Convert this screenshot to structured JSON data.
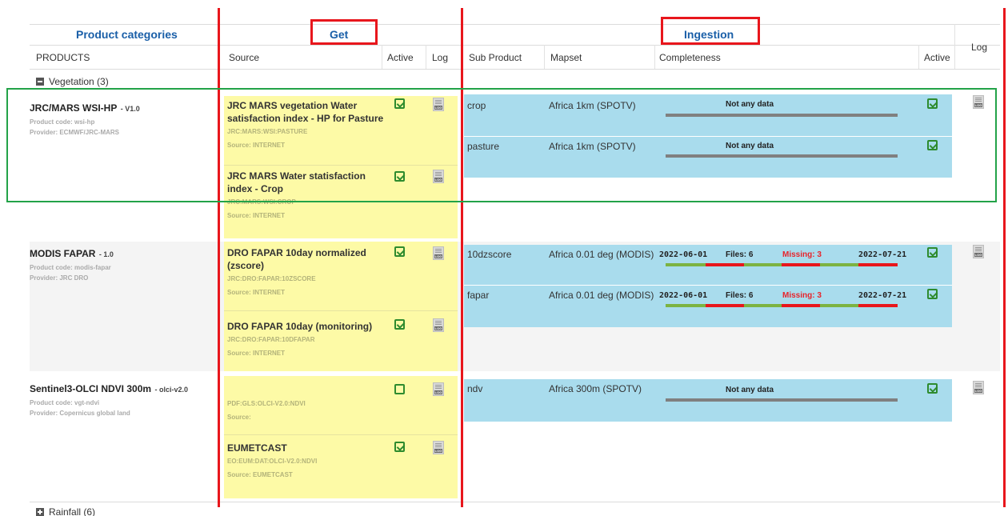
{
  "header": {
    "product_categories": "Product categories",
    "get": "Get",
    "ingestion": "Ingestion",
    "log": "Log"
  },
  "columns": {
    "products": "PRODUCTS",
    "source": "Source",
    "active": "Active",
    "log": "Log",
    "sub_product": "Sub Product",
    "mapset": "Mapset",
    "completeness": "Completeness",
    "ing_active": "Active"
  },
  "groups": {
    "vegetation": "Vegetation (3)",
    "rainfall": "Rainfall (6)"
  },
  "log_icon_text": "LOG",
  "products": [
    {
      "name": "JRC/MARS WSI-HP",
      "version": "- V1.0",
      "code": "Product code: wsi-hp",
      "provider": "Provider: ECMWF/JRC-MARS",
      "sources": [
        {
          "title": "JRC MARS vegetation Water satisfaction index - HP for Pasture",
          "code": "JRC:MARS:WSI:PASTURE",
          "src": "Source: INTERNET",
          "active": true
        },
        {
          "title": "JRC MARS Water statisfaction index - Crop",
          "code": "JRC:MARS:WSI:CROP",
          "src": "Source: INTERNET",
          "active": true
        }
      ],
      "ingestion": [
        {
          "sub": "crop",
          "mapset": "Africa 1km (SPOTV)",
          "status": "Not any data",
          "active": true
        },
        {
          "sub": "pasture",
          "mapset": "Africa 1km (SPOTV)",
          "status": "Not any data",
          "active": true
        }
      ]
    },
    {
      "name": "MODIS FAPAR",
      "version": "- 1.0",
      "code": "Product code: modis-fapar",
      "provider": "Provider: JRC DRO",
      "sources": [
        {
          "title": "DRO FAPAR 10day normalized (zscore)",
          "code": "JRC:DRO:FAPAR:10ZSCORE",
          "src": "Source: INTERNET",
          "active": true
        },
        {
          "title": "DRO FAPAR 10day (monitoring)",
          "code": "JRC:DRO:FAPAR:10DFAPAR",
          "src": "Source: INTERNET",
          "active": true
        }
      ],
      "ingestion": [
        {
          "sub": "10dzscore",
          "mapset": "Africa 0.01 deg (MODIS)",
          "start": "2022-06-01",
          "files": "Files: 6",
          "missing": "Missing: 3",
          "end": "2022-07-21",
          "active": true
        },
        {
          "sub": "fapar",
          "mapset": "Africa 0.01 deg (MODIS)",
          "start": "2022-06-01",
          "files": "Files: 6",
          "missing": "Missing: 3",
          "end": "2022-07-21",
          "active": true
        }
      ]
    },
    {
      "name": "Sentinel3-OLCI NDVI 300m",
      "version": "- olci-v2.0",
      "code": "Product code: vgt-ndvi",
      "provider": "Provider: Copernicus global land",
      "sources": [
        {
          "title": "",
          "code": "PDF:GLS:OLCI-V2.0:NDVI",
          "src": "Source:",
          "active": false
        },
        {
          "title": "EUMETCAST",
          "code": "EO:EUM:DAT:OLCI-V2.0:NDVI",
          "src": "Source: EUMETCAST",
          "active": true
        }
      ],
      "ingestion": [
        {
          "sub": "ndv",
          "mapset": "Africa 300m (SPOTV)",
          "status": "Not any data",
          "active": true
        }
      ]
    }
  ],
  "colors": {
    "source_bg": "#fdfaa6",
    "ingestion_bg": "#a9dced",
    "accent_blue": "#1a5fa8",
    "highlight_red": "#e8161c",
    "highlight_green": "#23a348",
    "bar_grey": "#808080",
    "bar_green": "#7cb342",
    "bar_red": "#e8161c"
  }
}
